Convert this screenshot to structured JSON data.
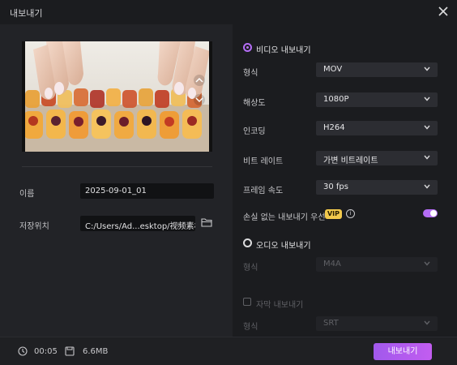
{
  "window": {
    "title": "내보내기"
  },
  "left": {
    "name_label": "이름",
    "name_value": "2025-09-01_01",
    "save_label": "저장위치",
    "save_value": "C:/Users/Ad...esktop/视频素材"
  },
  "video_section": {
    "title": "비디오 내보내기",
    "rows": [
      {
        "label": "형식",
        "value": "MOV"
      },
      {
        "label": "해상도",
        "value": "1080P"
      },
      {
        "label": "인코딩",
        "value": "H264"
      },
      {
        "label": "비트 레이트",
        "value": "가변 비트레이트"
      },
      {
        "label": "프레임 속도",
        "value": "30  fps"
      }
    ],
    "lossless_label": "손실 없는 내보내기 우선",
    "vip_badge": "VIP",
    "info_glyph": "i",
    "lossless_enabled": true
  },
  "audio_section": {
    "title": "오디오 내보내기",
    "format_label": "형식",
    "format_value": "M4A"
  },
  "subtitle_section": {
    "title": "자막 내보내기",
    "format_label": "형식",
    "format_value": "SRT",
    "checked": false
  },
  "footer": {
    "duration": "00:05",
    "size": "6.6MB",
    "export_label": "내보내기"
  },
  "colors": {
    "accent": "#b46df5",
    "vip": "#f2c94c",
    "background": "#1b1c1f"
  }
}
